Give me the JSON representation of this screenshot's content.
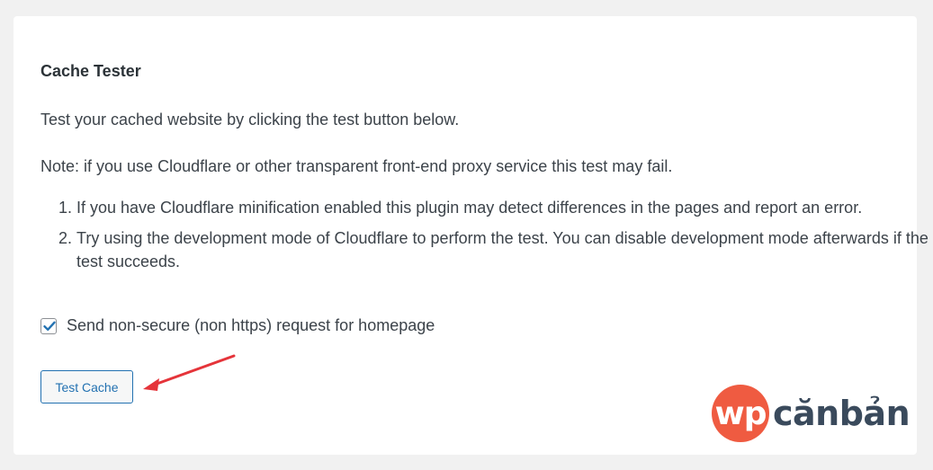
{
  "card": {
    "title": "Cache Tester",
    "intro": "Test your cached website by clicking the test button below.",
    "note": "Note: if you use Cloudflare or other transparent front-end proxy service this test may fail.",
    "steps": [
      "If you have Cloudflare minification enabled this plugin may detect differences in the pages and report an error.",
      "Try using the development mode of Cloudflare to perform the test. You can disable development mode afterwards if the test succeeds."
    ],
    "checkbox_label": "Send non-secure (non https) request for homepage",
    "checkbox_checked": true,
    "button_label": "Test Cache"
  },
  "watermark": {
    "circle_text": "wp",
    "text": "cănbản"
  },
  "colors": {
    "accent": "#2271b1",
    "arrow": "#e5343a",
    "logo_circle": "#ef5b41",
    "logo_text": "#3a4a5c"
  }
}
